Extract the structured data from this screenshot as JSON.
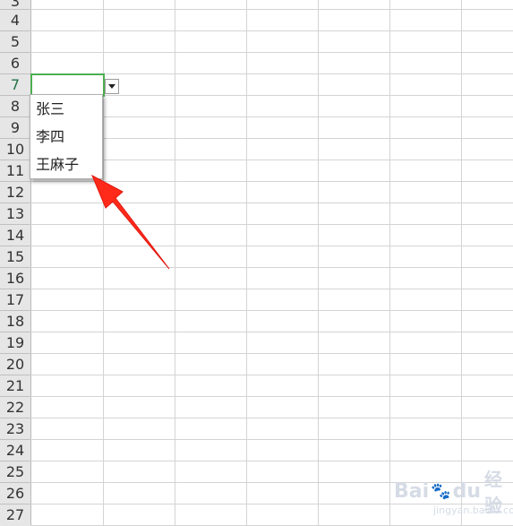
{
  "spreadsheet": {
    "rows": [
      "3",
      "4",
      "5",
      "6",
      "7",
      "8",
      "9",
      "10",
      "11",
      "12",
      "13",
      "14",
      "15",
      "16",
      "17",
      "18",
      "19",
      "20",
      "21",
      "22",
      "23",
      "24",
      "25",
      "26",
      "27"
    ],
    "active_row": "7"
  },
  "dropdown": {
    "items": [
      "张三",
      "李四",
      "王麻子"
    ]
  },
  "watermark": {
    "brand_a": "Bai",
    "brand_b": "du",
    "brand_cn": "经验",
    "sub": "jingyan.baidu.com"
  },
  "annotation": {
    "arrow_color": "#ff2a1a"
  },
  "colors": {
    "selection": "#4caf50",
    "header_bg": "#e6e6e6",
    "active_row_text": "#217346"
  }
}
